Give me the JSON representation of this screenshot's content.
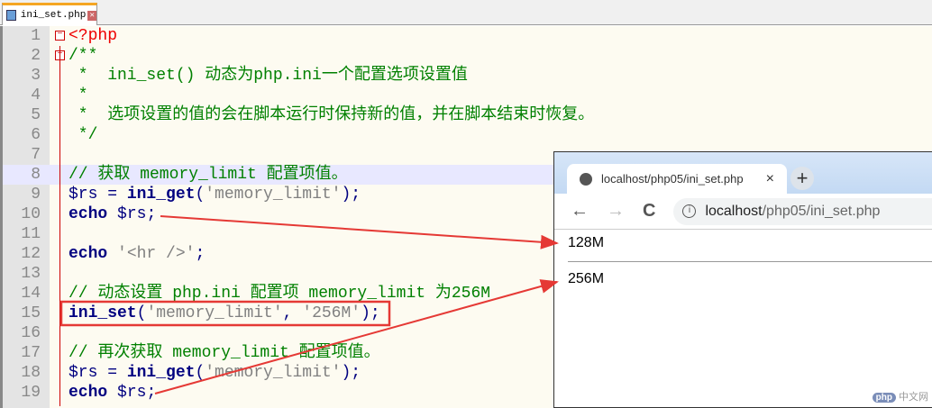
{
  "editor": {
    "tab_label": "ini_set.php",
    "highlighted_line": 8,
    "lines": [
      [
        [
          "php",
          "<?php"
        ]
      ],
      [
        [
          "cm",
          "/**"
        ]
      ],
      [
        [
          "cm",
          " *  ini_set() 动态为php.ini一个配置选项设置值"
        ]
      ],
      [
        [
          "cm",
          " *"
        ]
      ],
      [
        [
          "cm",
          " *  选项设置的值的会在脚本运行时保持新的值，并在脚本结束时恢复。"
        ]
      ],
      [
        [
          "cm",
          " */"
        ]
      ],
      [],
      [
        [
          "cm",
          "// 获取 memory_limit 配置项值。"
        ]
      ],
      [
        [
          "var",
          "$rs"
        ],
        [
          "op",
          " = "
        ],
        [
          "kw",
          "ini_get"
        ],
        [
          "op",
          "("
        ],
        [
          "str",
          "'memory_limit'"
        ],
        [
          "op",
          ");"
        ]
      ],
      [
        [
          "kw",
          "echo"
        ],
        [
          "var",
          " $rs"
        ],
        [
          "op",
          ";"
        ]
      ],
      [],
      [
        [
          "kw",
          "echo"
        ],
        [
          "str",
          " '<hr />'"
        ],
        [
          "op",
          ";"
        ]
      ],
      [],
      [
        [
          "cm",
          "// 动态设置 php.ini 配置项 memory_limit 为256M"
        ]
      ],
      [
        [
          "kw",
          "ini_set"
        ],
        [
          "op",
          "("
        ],
        [
          "str",
          "'memory_limit'"
        ],
        [
          "op",
          ", "
        ],
        [
          "str",
          "'256M'"
        ],
        [
          "op",
          ");"
        ]
      ],
      [],
      [
        [
          "cm",
          "// 再次获取 memory_limit 配置项值。"
        ]
      ],
      [
        [
          "var",
          "$rs"
        ],
        [
          "op",
          " = "
        ],
        [
          "kw",
          "ini_get"
        ],
        [
          "op",
          "("
        ],
        [
          "str",
          "'memory_limit'"
        ],
        [
          "op",
          ");"
        ]
      ],
      [
        [
          "kw",
          "echo"
        ],
        [
          "var",
          " $rs"
        ],
        [
          "op",
          ";"
        ]
      ]
    ]
  },
  "browser": {
    "tab_title": "localhost/php05/ini_set.php",
    "tab_close": "×",
    "new_tab": "+",
    "back": "←",
    "forward": "→",
    "reload": "C",
    "info": "i",
    "url_host": "localhost",
    "url_path": "/php05/ini_set.php",
    "output": [
      "128M",
      "256M"
    ]
  },
  "watermark": {
    "badge": "php",
    "text": "中文网"
  }
}
